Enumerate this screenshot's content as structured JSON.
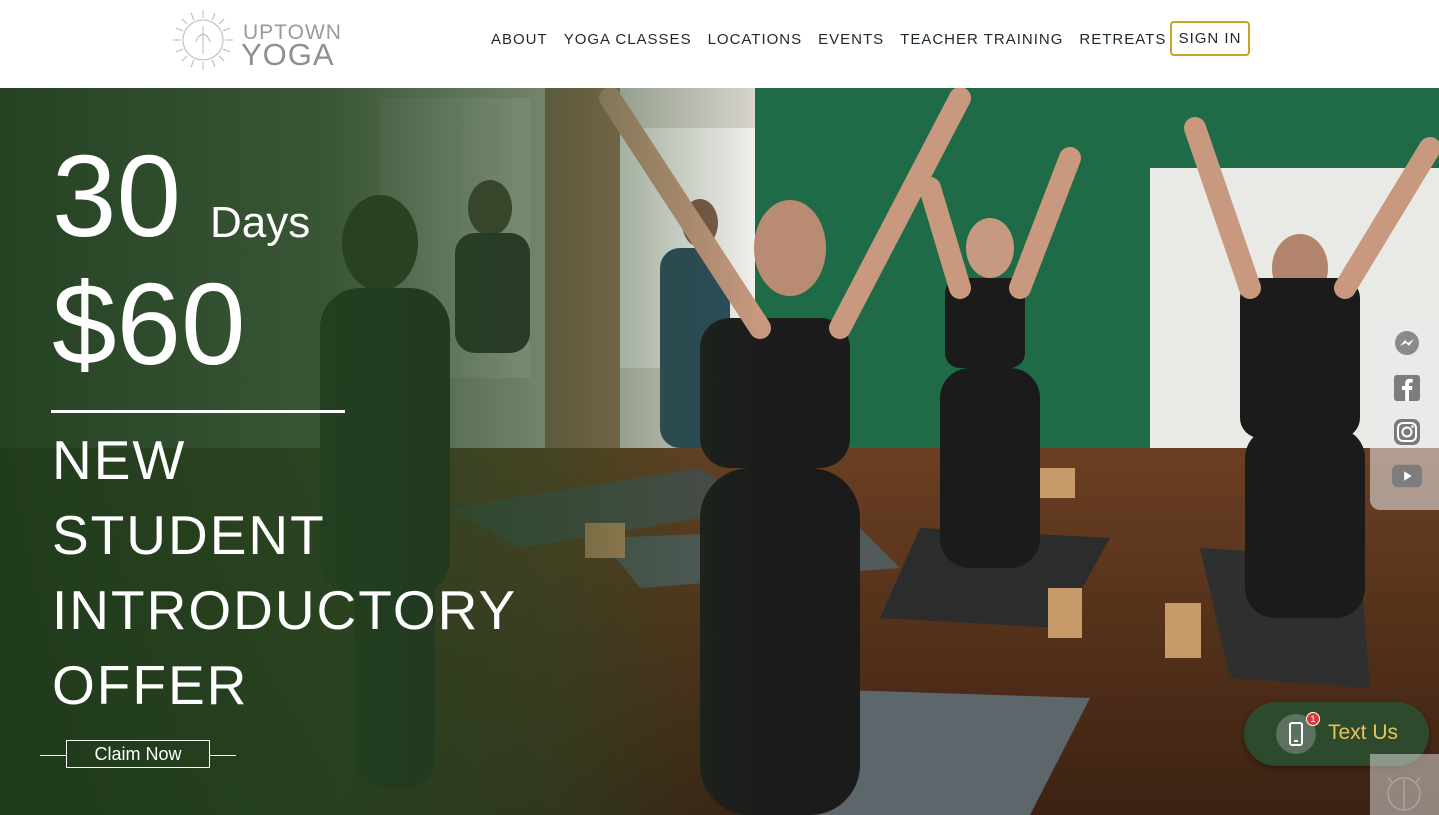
{
  "header": {
    "logo": {
      "line1": "UPTOWN",
      "line2": "YOGA"
    },
    "nav": [
      {
        "label": "ABOUT"
      },
      {
        "label": "YOGA CLASSES"
      },
      {
        "label": "LOCATIONS"
      },
      {
        "label": "EVENTS"
      },
      {
        "label": "TEACHER TRAINING"
      },
      {
        "label": "RETREATS"
      }
    ],
    "sign_in": "SIGN IN"
  },
  "hero": {
    "days_number": "30",
    "days_label": "Days",
    "price": "$60",
    "offer_lines": [
      "NEW",
      "STUDENT",
      "INTRODUCTORY",
      "OFFER"
    ],
    "cta": "Claim Now"
  },
  "social": {
    "icons": [
      "messenger-icon",
      "facebook-icon",
      "instagram-icon",
      "youtube-icon"
    ]
  },
  "text_widget": {
    "label": "Text Us",
    "badge": "1"
  },
  "colors": {
    "accent_gold": "#c9a227",
    "hero_green": "#2e4a2c",
    "nav_text": "#1f2a20",
    "text_us_label": "#e8c35b"
  }
}
